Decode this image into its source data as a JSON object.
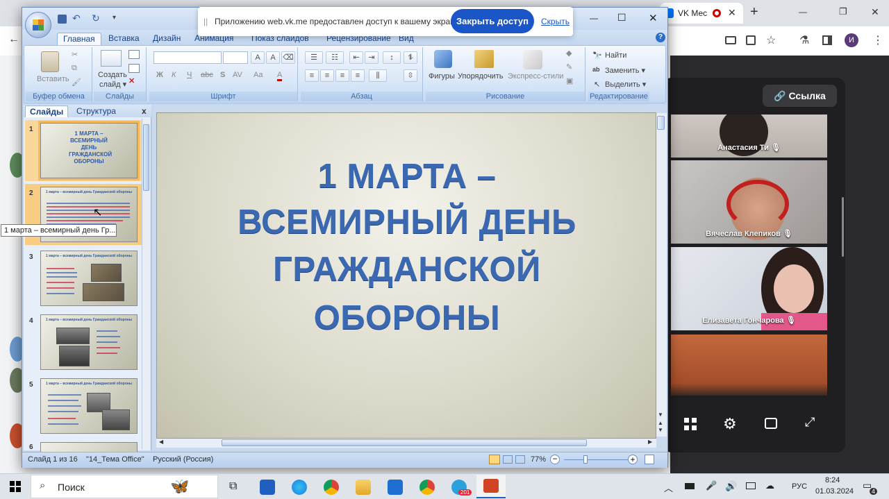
{
  "browser": {
    "tab_vk_label": "VK Мес",
    "window_controls": {
      "minimize": "—",
      "restore": "❐",
      "close": "✕"
    },
    "new_tab": "+",
    "avatar_letter": "И"
  },
  "ppt": {
    "window_controls": {
      "minimize": "—",
      "maximize": "☐",
      "close": "✕"
    },
    "help": "?",
    "ribbon_tabs": [
      "Главная",
      "Вставка",
      "Дизайн",
      "Анимация",
      "Показ слайдов",
      "Рецензирование",
      "Вид"
    ],
    "groups": {
      "clipboard": {
        "label": "Буфер обмена",
        "paste": "Вставить"
      },
      "slides": {
        "label": "Слайды",
        "new_slide_1": "Создать",
        "new_slide_2": "слайд ▾"
      },
      "font": {
        "label": "Шрифт",
        "bold": "Ж",
        "italic": "К",
        "underline": "Ч",
        "strike": "abc",
        "shadow": "S",
        "spacing": "AV",
        "case": "Aa",
        "color": "A",
        "grow": "A",
        "shrink": "A"
      },
      "paragraph": {
        "label": "Абзац"
      },
      "drawing": {
        "label": "Рисование",
        "shapes": "Фигуры",
        "arrange": "Упорядочить",
        "quick_styles": "Экспресс-стили"
      },
      "editing": {
        "label": "Редактирование",
        "find": "Найти",
        "replace": "Заменить ▾",
        "select": "Выделить ▾"
      }
    },
    "pane_tabs": {
      "slides": "Слайды",
      "outline": "Структура",
      "close": "x"
    },
    "thumbnails": [
      {
        "num": "1",
        "title": "1 МАРТА – ВСЕМИРНЫЙ ДЕНЬ ГРАЖДАНСКОЙ ОБОРОНЫ"
      },
      {
        "num": "2",
        "title": "1 марта – всемирный день Гражданской обороны"
      },
      {
        "num": "3",
        "title": "1 марта – всемирный день Гражданской обороны"
      },
      {
        "num": "4",
        "title": "1 марта – всемирный день Гражданской обороны"
      },
      {
        "num": "5",
        "title": "1 марта – всемирный день Гражданской обороны"
      },
      {
        "num": "6",
        "title": ""
      }
    ],
    "tooltip": "1 марта – всемирный день Гр...",
    "slide_title_lines": [
      "1 МАРТА –",
      "ВСЕМИРНЫЙ ДЕНЬ",
      "ГРАЖДАНСКОЙ",
      "ОБОРОНЫ"
    ],
    "status": {
      "slide_count": "Слайд 1 из 16",
      "theme": "\"14_Тема Office\"",
      "language": "Русский (Россия)",
      "zoom": "77%",
      "zoom_minus": "−",
      "zoom_plus": "+"
    }
  },
  "share_bar": {
    "grip": "||",
    "message": "Приложению web.vk.me предоставлен доступ к вашему экрану.",
    "stop_button": "Закрыть доступ",
    "hide_link": "Скрыть"
  },
  "vk_call": {
    "link_button": "Ссылка",
    "participants": [
      "Анастасия Ти",
      "Вячеслав Клепиков",
      "Елизавета Гончарова",
      ""
    ],
    "colors": {
      "accent": "#2a5cce"
    }
  },
  "taskbar": {
    "search_label": "Поиск",
    "language": "РУС",
    "time": "8:24",
    "date": "01.03.2024",
    "notifications": "4",
    "telegram_badge": "201"
  }
}
